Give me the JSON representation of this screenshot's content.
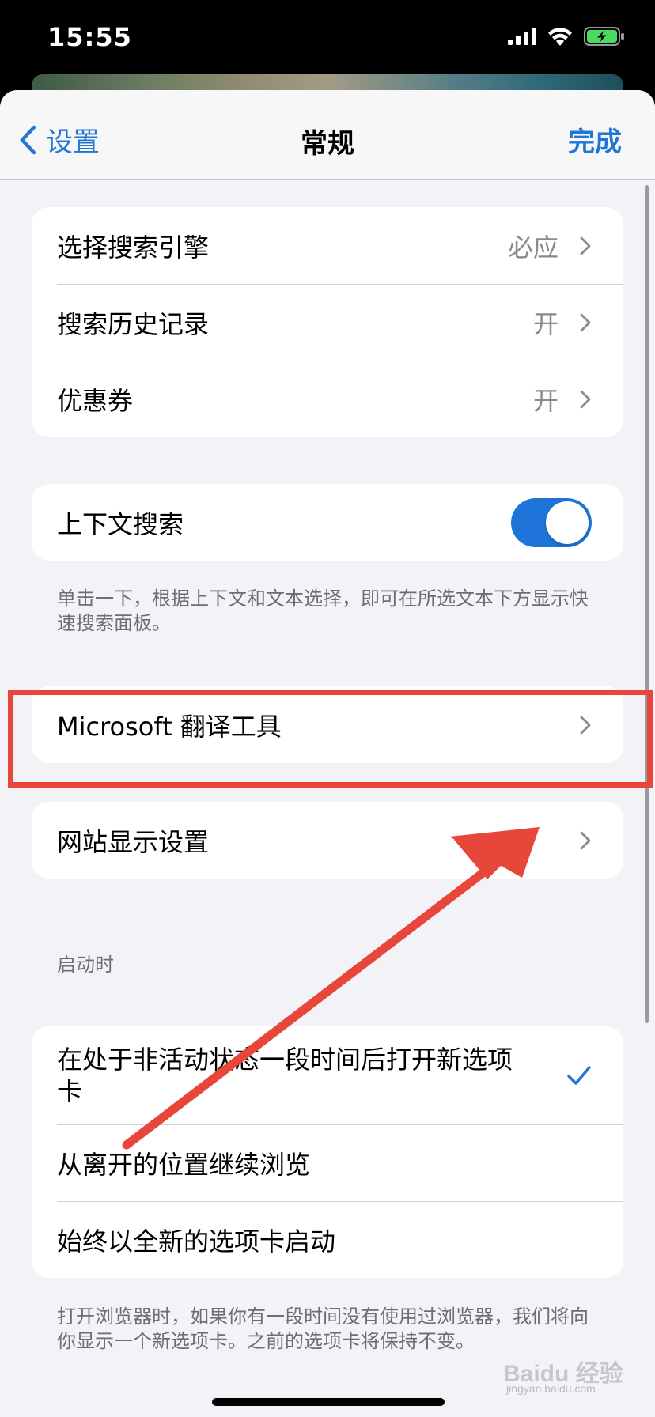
{
  "status_bar": {
    "time": "15:55"
  },
  "nav": {
    "back_label": "设置",
    "title": "常规",
    "done_label": "完成"
  },
  "search_group": {
    "items": [
      {
        "label": "选择搜索引擎",
        "value": "必应"
      },
      {
        "label": "搜索历史记录",
        "value": "开"
      },
      {
        "label": "优惠券",
        "value": "开"
      }
    ]
  },
  "context_search": {
    "label": "上下文搜索",
    "enabled": true,
    "footnote": "单击一下，根据上下文和文本选择，即可在所选文本下方显示快速搜索面板。"
  },
  "translate": {
    "label": "Microsoft 翻译工具"
  },
  "site_display": {
    "label": "网站显示设置"
  },
  "startup": {
    "header": "启动时",
    "options": [
      {
        "label": "在处于非活动状态一段时间后打开新选项卡",
        "selected": true
      },
      {
        "label": "从离开的位置继续浏览",
        "selected": false
      },
      {
        "label": "始终以全新的选项卡启动",
        "selected": false
      }
    ],
    "footnote": "打开浏览器时，如果你有一段时间没有使用过浏览器，我们将向你显示一个新选项卡。之前的选项卡将保持不变。"
  },
  "annotation": {
    "color": "#e8463a"
  },
  "accent_color": "#1f76d6",
  "watermark": {
    "brand": "Baidu 经验",
    "domain": "jingyan.baidu.com"
  }
}
